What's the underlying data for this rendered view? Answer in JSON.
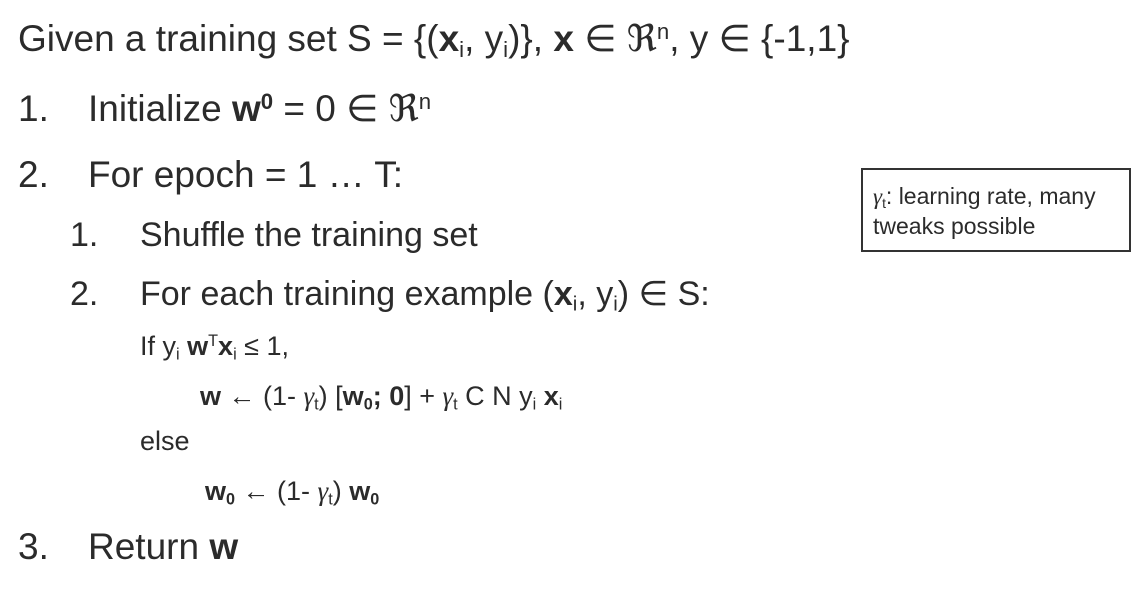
{
  "header": {
    "prefix": "Given a training set S = {(",
    "x": "x",
    "i1": "i",
    "comma": ", y",
    "i2": "i",
    "close": ")}, ",
    "x2": "x",
    "in_rn": " ∈ ",
    "frak": "ℜ",
    "n": "n",
    "yset": ", y ∈ {-1,1}"
  },
  "step1": {
    "num": "1.",
    "text": "Initialize ",
    "w": "w",
    "sup": "0",
    "rest": " = 0 ∈ ",
    "frak": "ℜ",
    "n": "n"
  },
  "step2": {
    "num": "2.",
    "text": "For epoch = 1 … T:"
  },
  "step2_1": {
    "num": "1.",
    "text": "Shuffle the training set"
  },
  "step2_2": {
    "num": "2.",
    "text": "For each training example (",
    "x": "x",
    "i1": "i",
    "comma": ", y",
    "i2": "i",
    "rest": ") ∈ S:"
  },
  "if_line": {
    "if": "If y",
    "i1": "i",
    "w": " w",
    "T": "T",
    "x": "x",
    "i2": "i",
    "rest": " ≤ 1,"
  },
  "update1": {
    "w": "w",
    "arrow": " ← (1- ",
    "gamma": "γ",
    "t1": "t",
    "mid": ") [",
    "w0": "w",
    "zero_sub": "0",
    "semi": "; 0",
    "close": "] + ",
    "gamma2": "γ",
    "t2": "t",
    "cn": " C N y",
    "i1": "i",
    "x": " x",
    "i2": "i"
  },
  "else_label": "else",
  "update2": {
    "w": "w",
    "sub": "0",
    "arrow": " ← (1- ",
    "gamma": "γ",
    "t": "t",
    "close": ") ",
    "w2": "w",
    "sub2": "0"
  },
  "step3": {
    "num": "3.",
    "text": "Return ",
    "w": "w"
  },
  "note": {
    "gamma": "γ",
    "t": "t",
    "text": ": learning rate, many tweaks possible"
  }
}
